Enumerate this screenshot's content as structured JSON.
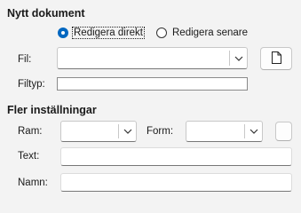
{
  "new_document": {
    "heading": "Nytt dokument",
    "radio_edit_now": "Redigera direkt",
    "radio_edit_later": "Redigera senare",
    "file_label": "Fil:",
    "file_value": "",
    "filetype_label": "Filtyp:",
    "filetype_value": ""
  },
  "more_settings": {
    "heading": "Fler inställningar",
    "frame_label": "Ram:",
    "frame_value": "",
    "form_label": "Form:",
    "form_value": "",
    "text_label": "Text:",
    "text_value": "",
    "name_label": "Namn:",
    "name_value": ""
  },
  "icons": {
    "new_file": "document-icon",
    "dropdown": "chevron-down-icon"
  }
}
